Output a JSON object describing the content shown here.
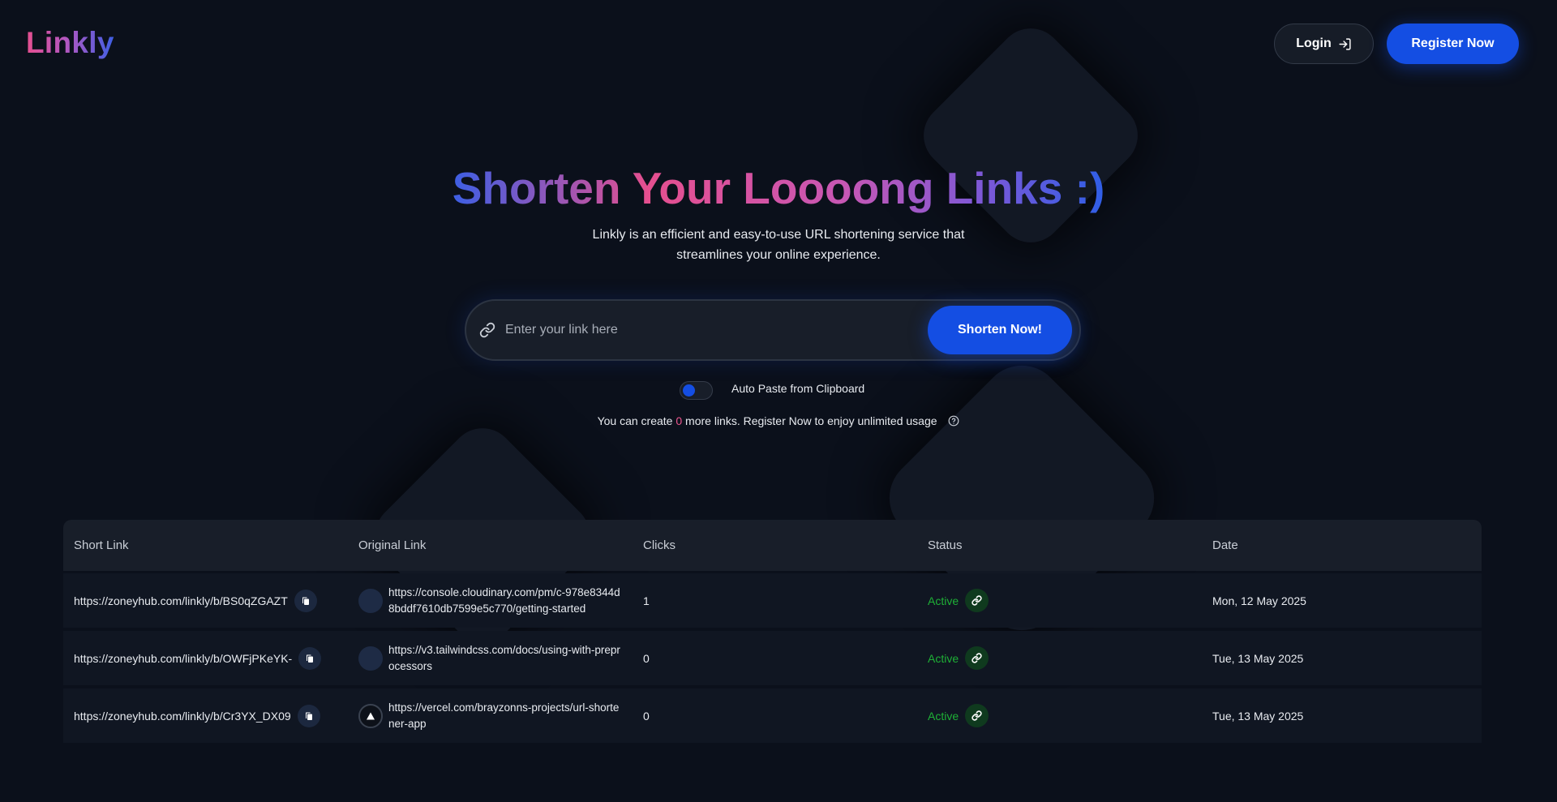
{
  "header": {
    "logo": "Linkly",
    "login_label": "Login",
    "register_label": "Register Now"
  },
  "hero": {
    "title": "Shorten Your Loooong Links :)",
    "subtitle": "Linkly is an efficient and easy-to-use URL shortening service that streamlines your online experience."
  },
  "search": {
    "placeholder": "Enter your link here",
    "value": "",
    "button_label": "Shorten Now!"
  },
  "auto_paste": {
    "label": "Auto Paste from Clipboard",
    "enabled": false
  },
  "limit": {
    "prefix": "You can create ",
    "count": "0",
    "suffix": " more links. Register Now to enjoy unlimited usage"
  },
  "table": {
    "headers": [
      "Short Link",
      "Original Link",
      "Clicks",
      "Status",
      "Date"
    ],
    "rows": [
      {
        "short": "https://zoneyhub.com/linkly/b/BS0qZGAZT",
        "original": "https://console.cloudinary.com/pm/c-978e8344d8bddf7610db7599e5c770/getting-started",
        "favicon": "blank-favicon",
        "clicks": "1",
        "status": "Active",
        "date": "Mon, 12 May 2025"
      },
      {
        "short": "https://zoneyhub.com/linkly/b/OWFjPKeYK-",
        "original": "https://v3.tailwindcss.com/docs/using-with-preprocessors",
        "favicon": "blank-favicon",
        "clicks": "0",
        "status": "Active",
        "date": "Tue, 13 May 2025"
      },
      {
        "short": "https://zoneyhub.com/linkly/b/Cr3YX_DX09",
        "original": "https://vercel.com/brayzonns-projects/url-shortener-app",
        "favicon": "vercel-triangle-icon",
        "clicks": "0",
        "status": "Active",
        "date": "Tue, 13 May 2025"
      }
    ]
  },
  "colors": {
    "background": "#0b101b",
    "primary": "#144ee3",
    "pink": "#eb568e",
    "active_green": "#1eb036"
  }
}
